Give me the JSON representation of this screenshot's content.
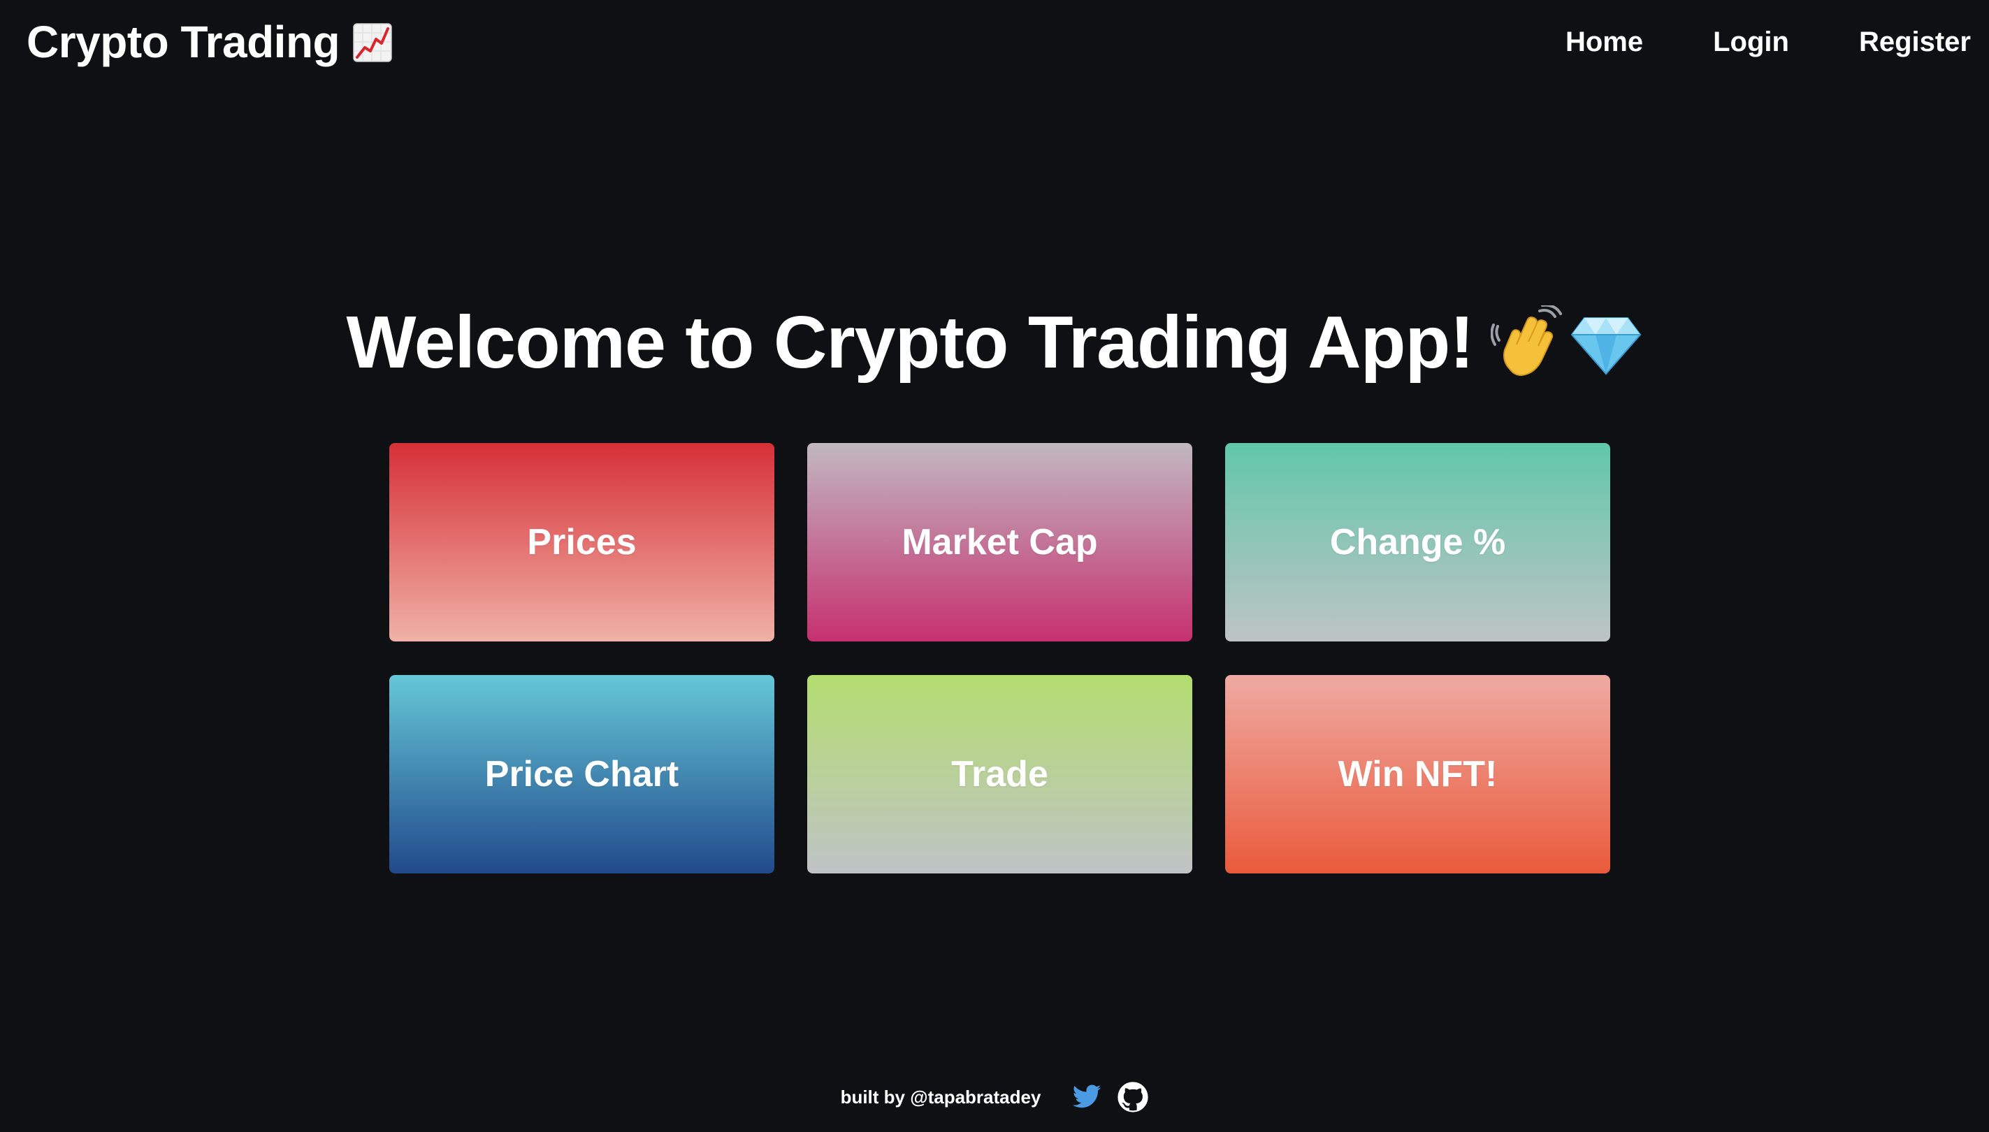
{
  "header": {
    "brand": "Crypto Trading",
    "brand_icon": "chart-increasing-icon",
    "nav": [
      {
        "label": "Home"
      },
      {
        "label": "Login"
      },
      {
        "label": "Register"
      }
    ]
  },
  "main": {
    "welcome": "Welcome to Crypto Trading App!",
    "welcome_icons": [
      "waving-hand-icon",
      "gem-stone-icon"
    ],
    "cards": [
      {
        "label": "Prices",
        "colors": [
          "#d62f37",
          "#f0b1a6"
        ]
      },
      {
        "label": "Market Cap",
        "colors": [
          "#c1b8c1",
          "#c6306f"
        ]
      },
      {
        "label": "Change %",
        "colors": [
          "#61c7aa",
          "#bec3c6"
        ]
      },
      {
        "label": "Price Chart",
        "colors": [
          "#65c7d7",
          "#21498b"
        ]
      },
      {
        "label": "Trade",
        "colors": [
          "#b3dc6e",
          "#bfc3c6"
        ]
      },
      {
        "label": "Win NFT!",
        "colors": [
          "#eeaaa2",
          "#ea5a3b"
        ]
      }
    ]
  },
  "footer": {
    "text": "built by @tapabratadey",
    "icons": [
      "twitter-icon",
      "github-icon"
    ]
  },
  "theme": {
    "background": "#0f1013",
    "text": "#ffffff",
    "twitter_blue": "#4a9be3"
  }
}
